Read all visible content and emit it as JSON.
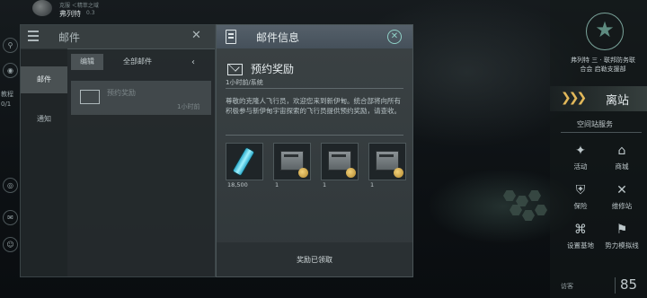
{
  "topbar": {
    "location": "克服 ＜精萃之域",
    "player_name": "弗列特",
    "player_level": "0.3"
  },
  "left_edge": {
    "tutorial_label": "教程",
    "tutorial_progress": "0/1"
  },
  "mail_list": {
    "title": "邮件",
    "categories": [
      {
        "label": "邮件",
        "active": true
      },
      {
        "label": "通知",
        "active": false
      }
    ],
    "edit_label": "编辑",
    "all_mail_label": "全部邮件",
    "items": [
      {
        "name": "预约奖励",
        "time": "1小时前"
      }
    ]
  },
  "mail_detail": {
    "header_title": "邮件信息",
    "subject": "预约奖励",
    "meta": "1小时前/系统",
    "body": "尊敬的克隆人飞行员，欢迎您来到新伊甸。统合部将向所有积极参与新伊甸宇宙探索的飞行员提供预约奖励，请查收。",
    "attachments": [
      {
        "icon": "booster-canister-icon",
        "count": "18,500"
      },
      {
        "icon": "crate-icon",
        "count": "1"
      },
      {
        "icon": "crate-icon",
        "count": "1"
      },
      {
        "icon": "crate-icon",
        "count": "1"
      }
    ],
    "status": "奖励已领取"
  },
  "right_panel": {
    "corp_line1": "弗列特 三 · 联邦防务联",
    "corp_line2": "合会 启勒支援部",
    "undock_label": "离站",
    "services_title": "空间站服务",
    "services": [
      {
        "label": "活动",
        "icon": "activity-icon"
      },
      {
        "label": "商城",
        "icon": "shop-icon"
      },
      {
        "label": "保险",
        "icon": "insurance-icon"
      },
      {
        "label": "维修站",
        "icon": "repair-icon"
      },
      {
        "label": "设置基地",
        "icon": "set-home-icon"
      },
      {
        "label": "势力模拟线",
        "icon": "faction-icon"
      }
    ],
    "visitor_label": "访客",
    "counter": "85"
  },
  "colors": {
    "accent": "#8fd0c6",
    "undock_chevron": "#e2b85a",
    "panel_bg": "#30373a"
  }
}
